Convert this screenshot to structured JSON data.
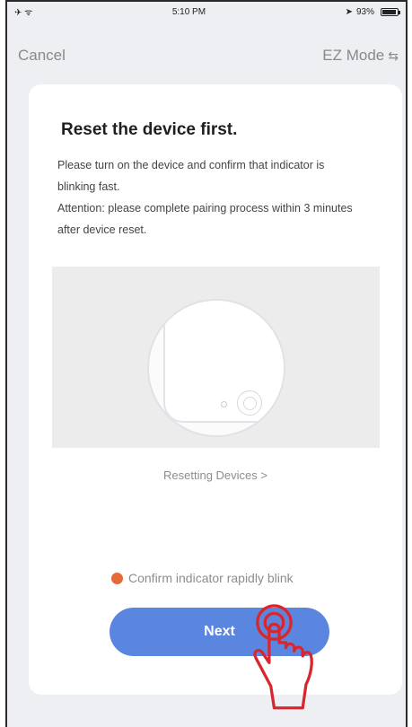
{
  "status_bar": {
    "left_icons": "✈ ᯤ",
    "time": "5:10 PM",
    "right_text": "93%"
  },
  "nav": {
    "cancel_label": "Cancel",
    "mode_label": "EZ Mode",
    "mode_icon": "swap-arrows-icon"
  },
  "card": {
    "title": "Reset the device first.",
    "description_line1": "Please turn on the device and confirm that indicator is blinking fast.",
    "description_line2": "Attention: please complete pairing process within 3 minutes after device reset.",
    "resetting_link": "Resetting Devices >",
    "confirm_text": "Confirm indicator rapidly blink",
    "next_label": "Next"
  },
  "colors": {
    "accent_blue": "#5b86e0",
    "confirm_orange": "#e46a3a",
    "hand_red": "#d8262e"
  }
}
